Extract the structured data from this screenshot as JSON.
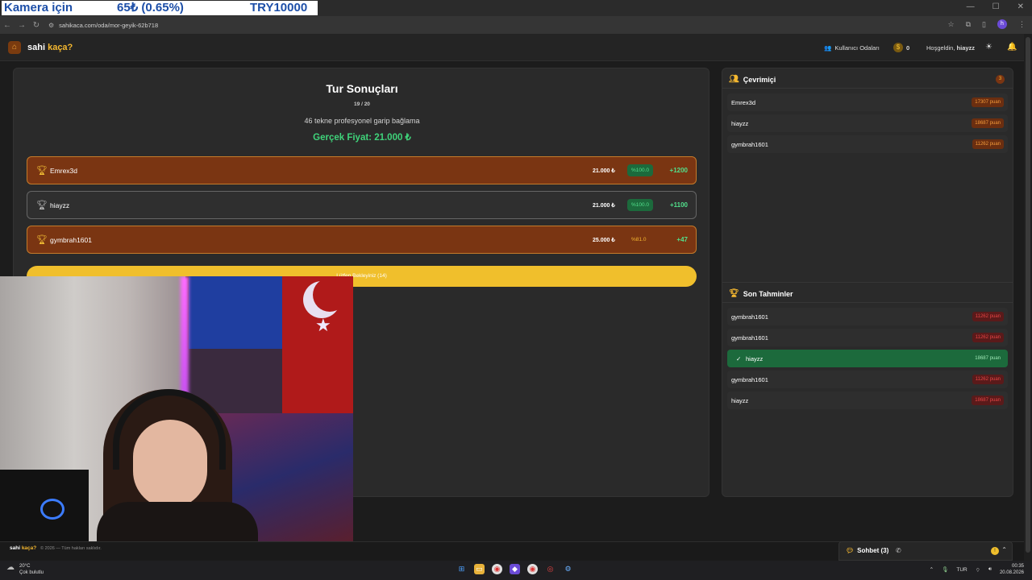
{
  "overlay": {
    "left": "Kamera için",
    "mid": "65₺ (0.65%)",
    "right": "TRY10000"
  },
  "browser": {
    "url": "sahikaca.com/oda/mor-geyik-62b718",
    "profile_initial": "h"
  },
  "header": {
    "logo_main": "sahi ",
    "logo_accent": "kaça?",
    "rooms_link": "Kullanıcı Odaları",
    "coins": "0",
    "welcome_prefix": "Hoşgeldin, ",
    "welcome_user": "hiayzz"
  },
  "round": {
    "title": "Tur Sonuçları",
    "count": "19 / 20",
    "item": "46 tekne profesyonel garip bağlama",
    "true_price": "Gerçek Fiyat: 21.000 ₺"
  },
  "results": [
    {
      "name": "Emrex3d",
      "price": "21.000 ₺",
      "accuracy": "%100.0",
      "points": "+1200"
    },
    {
      "name": "hiayzz",
      "price": "21.000 ₺",
      "accuracy": "%100.0",
      "points": "+1100"
    },
    {
      "name": "gymbrah1601",
      "price": "25.000 ₺",
      "accuracy": "%81.0",
      "points": "+47"
    }
  ],
  "wait_button": "Lütfen Bekleyiniz (14)",
  "online": {
    "title": "Çevrimiçi",
    "count": "3",
    "users": [
      {
        "name": "Emrex3d",
        "points": "17307 puan"
      },
      {
        "name": "hiayzz",
        "points": "18687 puan"
      },
      {
        "name": "gymbrah1601",
        "points": "11262 puan"
      }
    ]
  },
  "recent": {
    "title": "Son Tahminler",
    "items": [
      {
        "name": "gymbrah1601",
        "points": "11262 puan"
      },
      {
        "name": "gymbrah1601",
        "points": "11262 puan"
      },
      {
        "name": "hiayzz",
        "points": "18687 puan"
      },
      {
        "name": "gymbrah1601",
        "points": "11262 puan"
      },
      {
        "name": "hiayzz",
        "points": "18687 puan"
      }
    ]
  },
  "footer": {
    "logo_main": "sahi ",
    "logo_accent": "kaça?",
    "copyright": "© 2026 — Tüm hakları saklıdır."
  },
  "chat": {
    "label": "Sohbet (3)",
    "badge": "!"
  },
  "taskbar": {
    "temp": "20°C",
    "weather": "Çok bulutlu",
    "lang": "TUR",
    "time": "00:35",
    "date": "20.08.2026"
  },
  "colors": {
    "accent": "#f5b830",
    "win_row": "#7a3512",
    "success": "#3fd37a",
    "danger": "#e64545"
  }
}
